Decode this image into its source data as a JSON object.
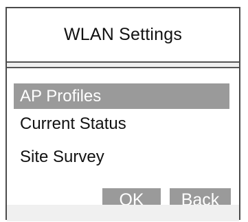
{
  "dialog": {
    "title": "WLAN Settings"
  },
  "menu": {
    "items": [
      {
        "label": "AP Profiles",
        "selected": true
      },
      {
        "label": "Current Status",
        "selected": false
      },
      {
        "label": "Site Survey",
        "selected": false
      }
    ]
  },
  "buttons": {
    "ok_label": "OK",
    "back_label": "Back"
  },
  "colors": {
    "selection": "#9a9a9a",
    "border": "#4a4a4a",
    "text": "#111111",
    "button_text": "#ffffff"
  }
}
